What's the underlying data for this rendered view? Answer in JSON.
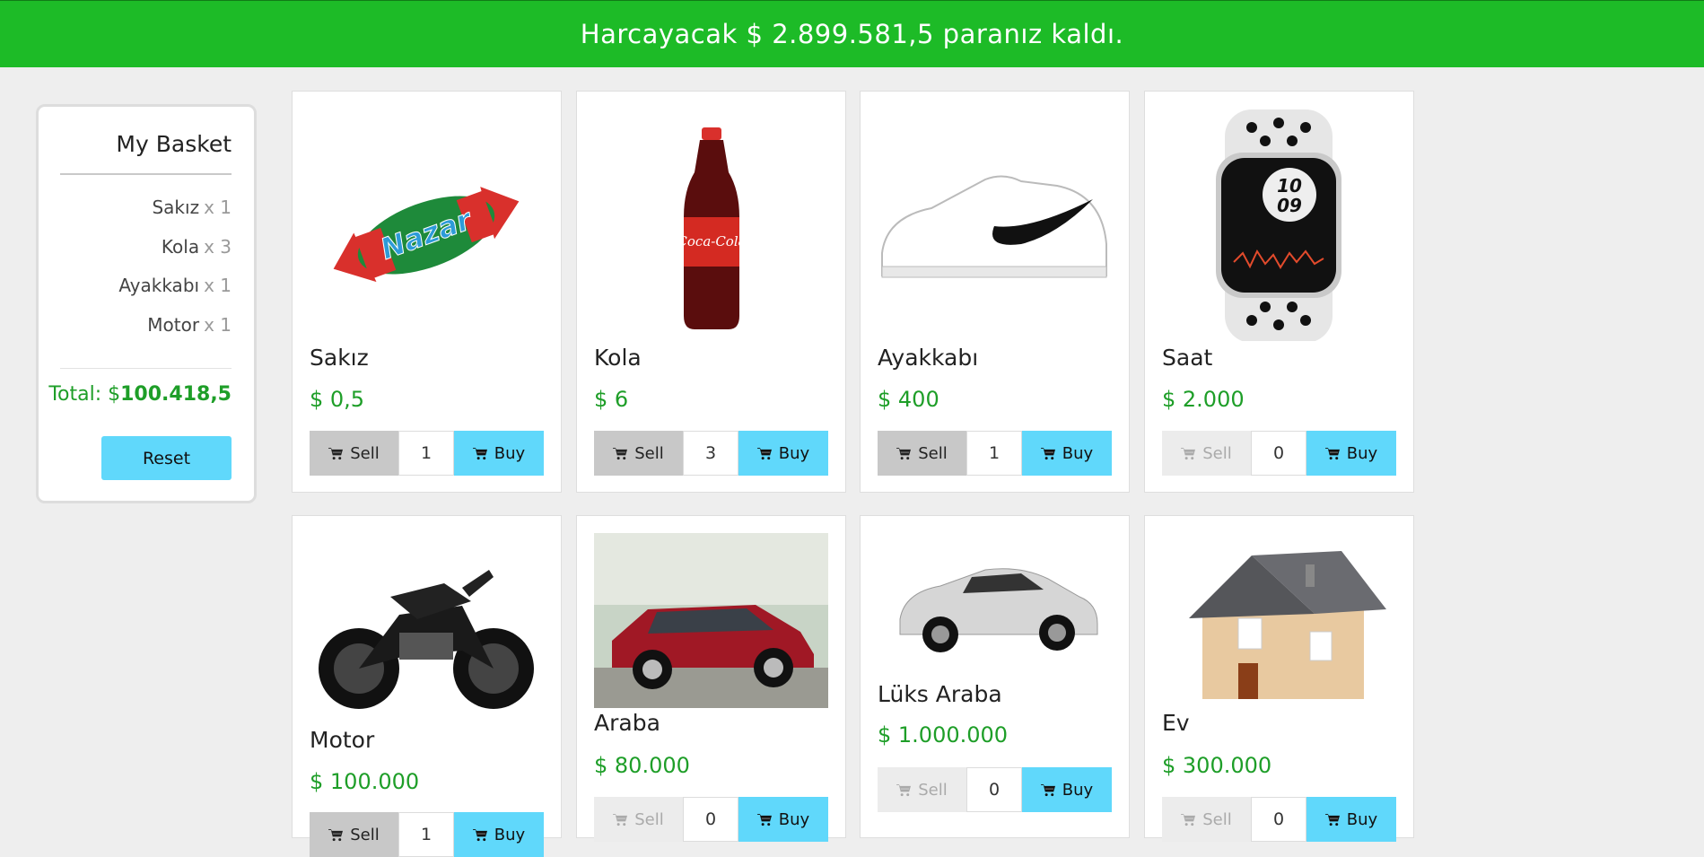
{
  "banner": {
    "text": "Harcayacak $ 2.899.581,5 paranız kaldı."
  },
  "basket": {
    "title": "My Basket",
    "items": [
      {
        "name": "Sakız",
        "qty": "x 1"
      },
      {
        "name": "Kola",
        "qty": "x 3"
      },
      {
        "name": "Ayakkabı",
        "qty": "x 1"
      },
      {
        "name": "Motor",
        "qty": "x 1"
      }
    ],
    "total_label": "Total: $",
    "total_value": "100.418,5",
    "reset_label": "Reset"
  },
  "buttons": {
    "sell_label": "Sell",
    "buy_label": "Buy"
  },
  "products": [
    {
      "name": "Sakız",
      "price": "$ 0,5",
      "count": "1"
    },
    {
      "name": "Kola",
      "price": "$ 6",
      "count": "3"
    },
    {
      "name": "Ayakkabı",
      "price": "$ 400",
      "count": "1"
    },
    {
      "name": "Saat",
      "price": "$ 2.000",
      "count": "0"
    },
    {
      "name": "Motor",
      "price": "$ 100.000",
      "count": "1"
    },
    {
      "name": "Araba",
      "price": "$ 80.000",
      "count": "0"
    },
    {
      "name": "Lüks Araba",
      "price": "$ 1.000.000",
      "count": "0"
    },
    {
      "name": "Ev",
      "price": "$ 300.000",
      "count": "0"
    }
  ],
  "product_images": {
    "candy_text": "Nazar",
    "watch_time_top": "10",
    "watch_time_bottom": "09",
    "cola_text": "Coca-Cola"
  },
  "colors": {
    "banner": "#1dbb27",
    "price": "#1e9e28",
    "buy": "#60d8fb",
    "sell": "#c8c8c8"
  }
}
